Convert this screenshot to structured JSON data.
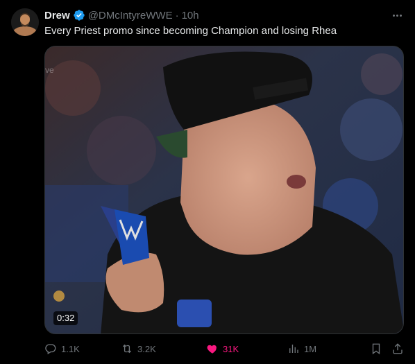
{
  "author": {
    "name": "Drew",
    "handle": "@DMcIntyreWWE",
    "separator": "·",
    "time": "10h",
    "verified": true
  },
  "tweet": {
    "text": "Every Priest promo since becoming Champion and losing Rhea"
  },
  "media": {
    "duration": "0:32",
    "watermark": "ve"
  },
  "actions": {
    "replies": "1.1K",
    "reposts": "3.2K",
    "likes": "31K",
    "views": "1M",
    "liked": true
  },
  "icons": {
    "reply": "reply-icon",
    "repost": "repost-icon",
    "like": "heart-icon",
    "views": "views-icon",
    "bookmark": "bookmark-icon",
    "share": "share-icon",
    "more": "more-icon",
    "verified": "verified-badge-icon"
  },
  "colors": {
    "background": "#000000",
    "text": "#e7e9ea",
    "secondary": "#71767b",
    "like": "#f91880",
    "verified": "#1d9bf0"
  }
}
